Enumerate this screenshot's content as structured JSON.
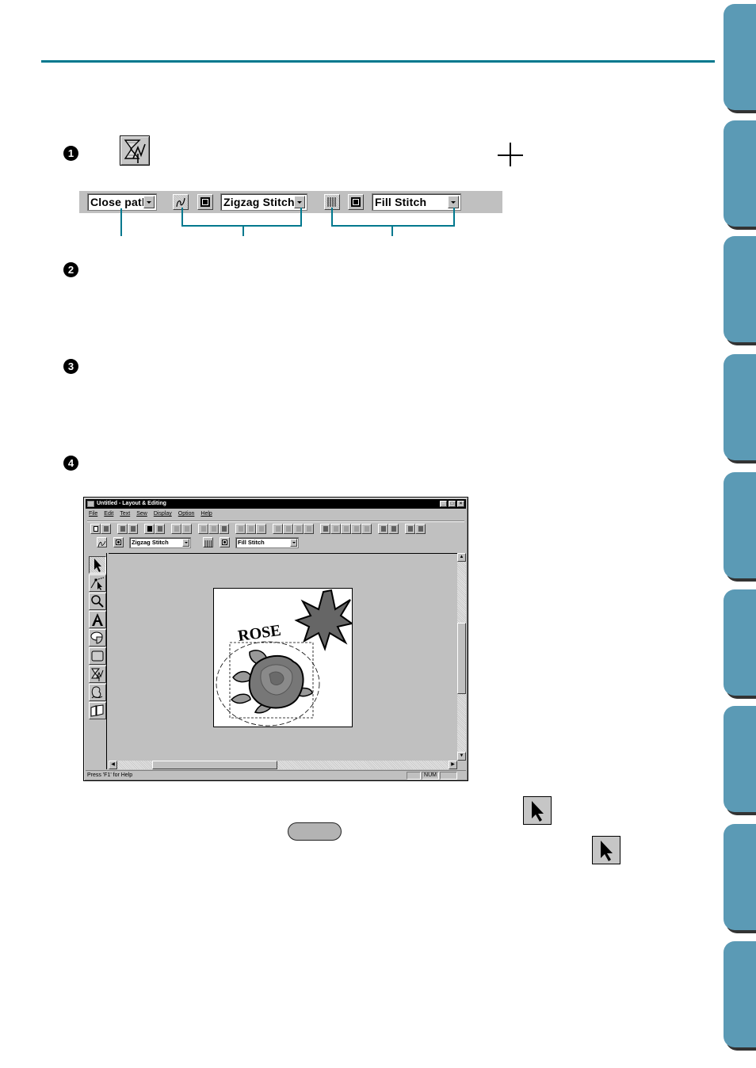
{
  "page": {
    "accent_color": "#00788e",
    "tab_color": "#5b9ab5",
    "side_tab_count": 9
  },
  "steps": [
    {
      "number": "1"
    },
    {
      "number": "2"
    },
    {
      "number": "3"
    },
    {
      "number": "4"
    }
  ],
  "icons": {
    "outline_tool": "outline-tool-icon",
    "crosshair": "crosshair-cursor-icon",
    "select": "select-arrow-icon"
  },
  "enlarged_toolbar": {
    "path_mode": {
      "value": "Close path"
    },
    "line_sew": {
      "stitch": "Zigzag Stitch"
    },
    "region_sew": {
      "stitch": "Fill Stitch"
    }
  },
  "app_window": {
    "title": "Untitled - Layout & Editing",
    "caption_buttons": [
      "_",
      "□",
      "×"
    ],
    "menu": [
      "File",
      "Edit",
      "Text",
      "Sew",
      "Display",
      "Option",
      "Help"
    ],
    "line_stitch": "Zigzag Stitch",
    "region_stitch": "Fill Stitch",
    "canvas_text": "ROSE",
    "status_text": "Press 'F1' for Help",
    "status_indicators": [
      "",
      "NUM",
      ""
    ],
    "tools": [
      "select",
      "point-edit",
      "zoom",
      "text",
      "shape",
      "rectangle",
      "outline",
      "brush",
      "import"
    ]
  },
  "key_button": {
    "label": ""
  }
}
